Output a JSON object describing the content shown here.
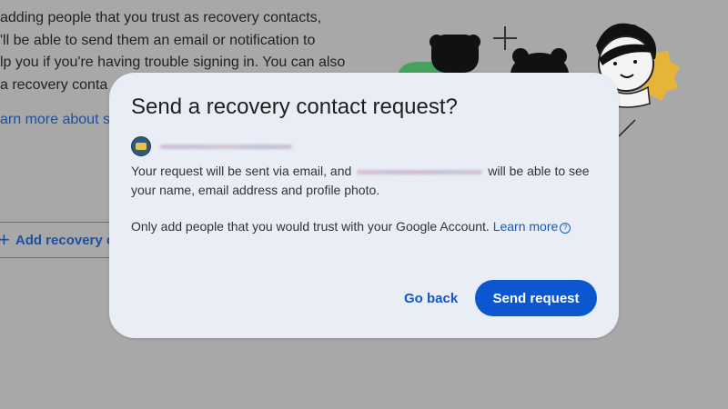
{
  "background": {
    "lines": [
      "adding people that you trust as recovery contacts,",
      "'ll be able to send them an email or notification to",
      "lp you if you're having trouble signing in. You can also",
      "a recovery conta"
    ],
    "learn_more_link": "arn more about s",
    "add_button_label": "Add recovery c"
  },
  "dialog": {
    "title": "Send a recovery contact request?",
    "body_before": "Your request will be sent via email, and",
    "body_after": "will be able to see your name, email address and profile photo.",
    "notice": "Only add people that you would trust with your Google Account.",
    "learn_more": "Learn more",
    "go_back": "Go back",
    "send_request": "Send request"
  },
  "colors": {
    "accent": "#0b57d0",
    "dialog_bg": "#e8edf6",
    "scrim": "#a8a8a8"
  },
  "icons": {
    "plus": "plus-icon",
    "help": "help-circle-icon"
  }
}
